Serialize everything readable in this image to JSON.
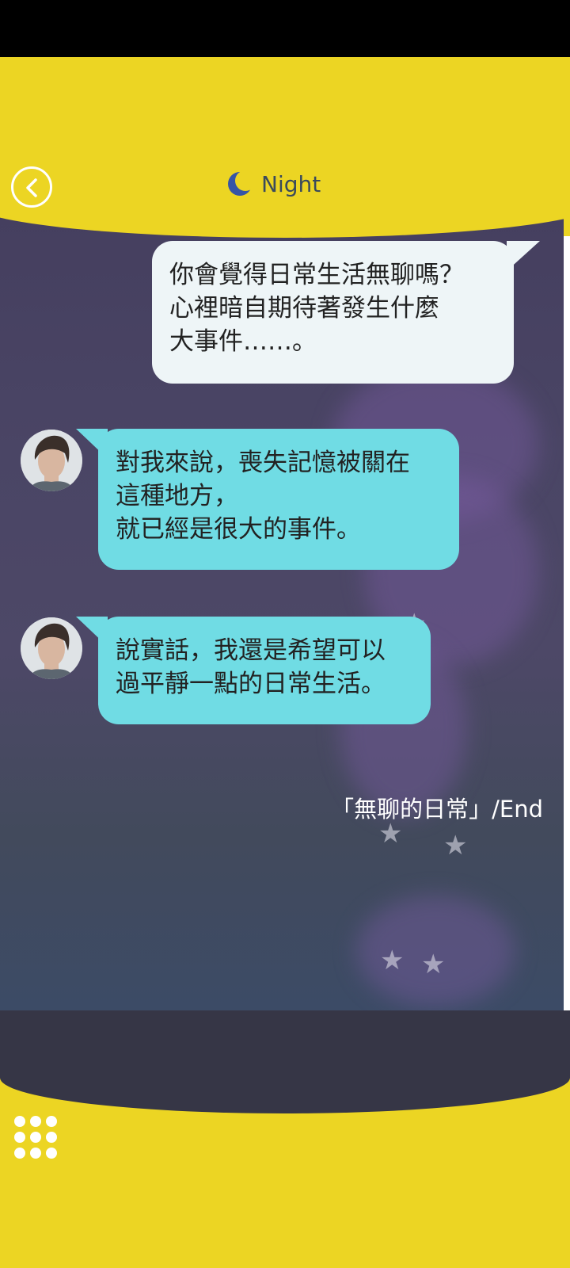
{
  "header": {
    "title": "Night",
    "back_icon": "back-arrow-icon",
    "time_icon": "moon-icon"
  },
  "messages": [
    {
      "sender": "me",
      "text": "你會覺得日常生活無聊嗎？\n心裡暗自期待著發生什麼\n大事件……。"
    },
    {
      "sender": "other",
      "text": "對我來說，喪失記憶被關在\n這種地方，\n就已經是很大的事件。"
    },
    {
      "sender": "other",
      "text": "說實話，我還是希望可以\n過平靜一點的日常生活。"
    }
  ],
  "ending_label": "「無聊的日常」/End",
  "footer": {
    "menu_icon": "grid-menu-icon"
  },
  "colors": {
    "frame": "#ECD523",
    "bubble_me": "#EEF5F7",
    "bubble_other": "#70DCE4",
    "bottom_band": "#363646"
  }
}
